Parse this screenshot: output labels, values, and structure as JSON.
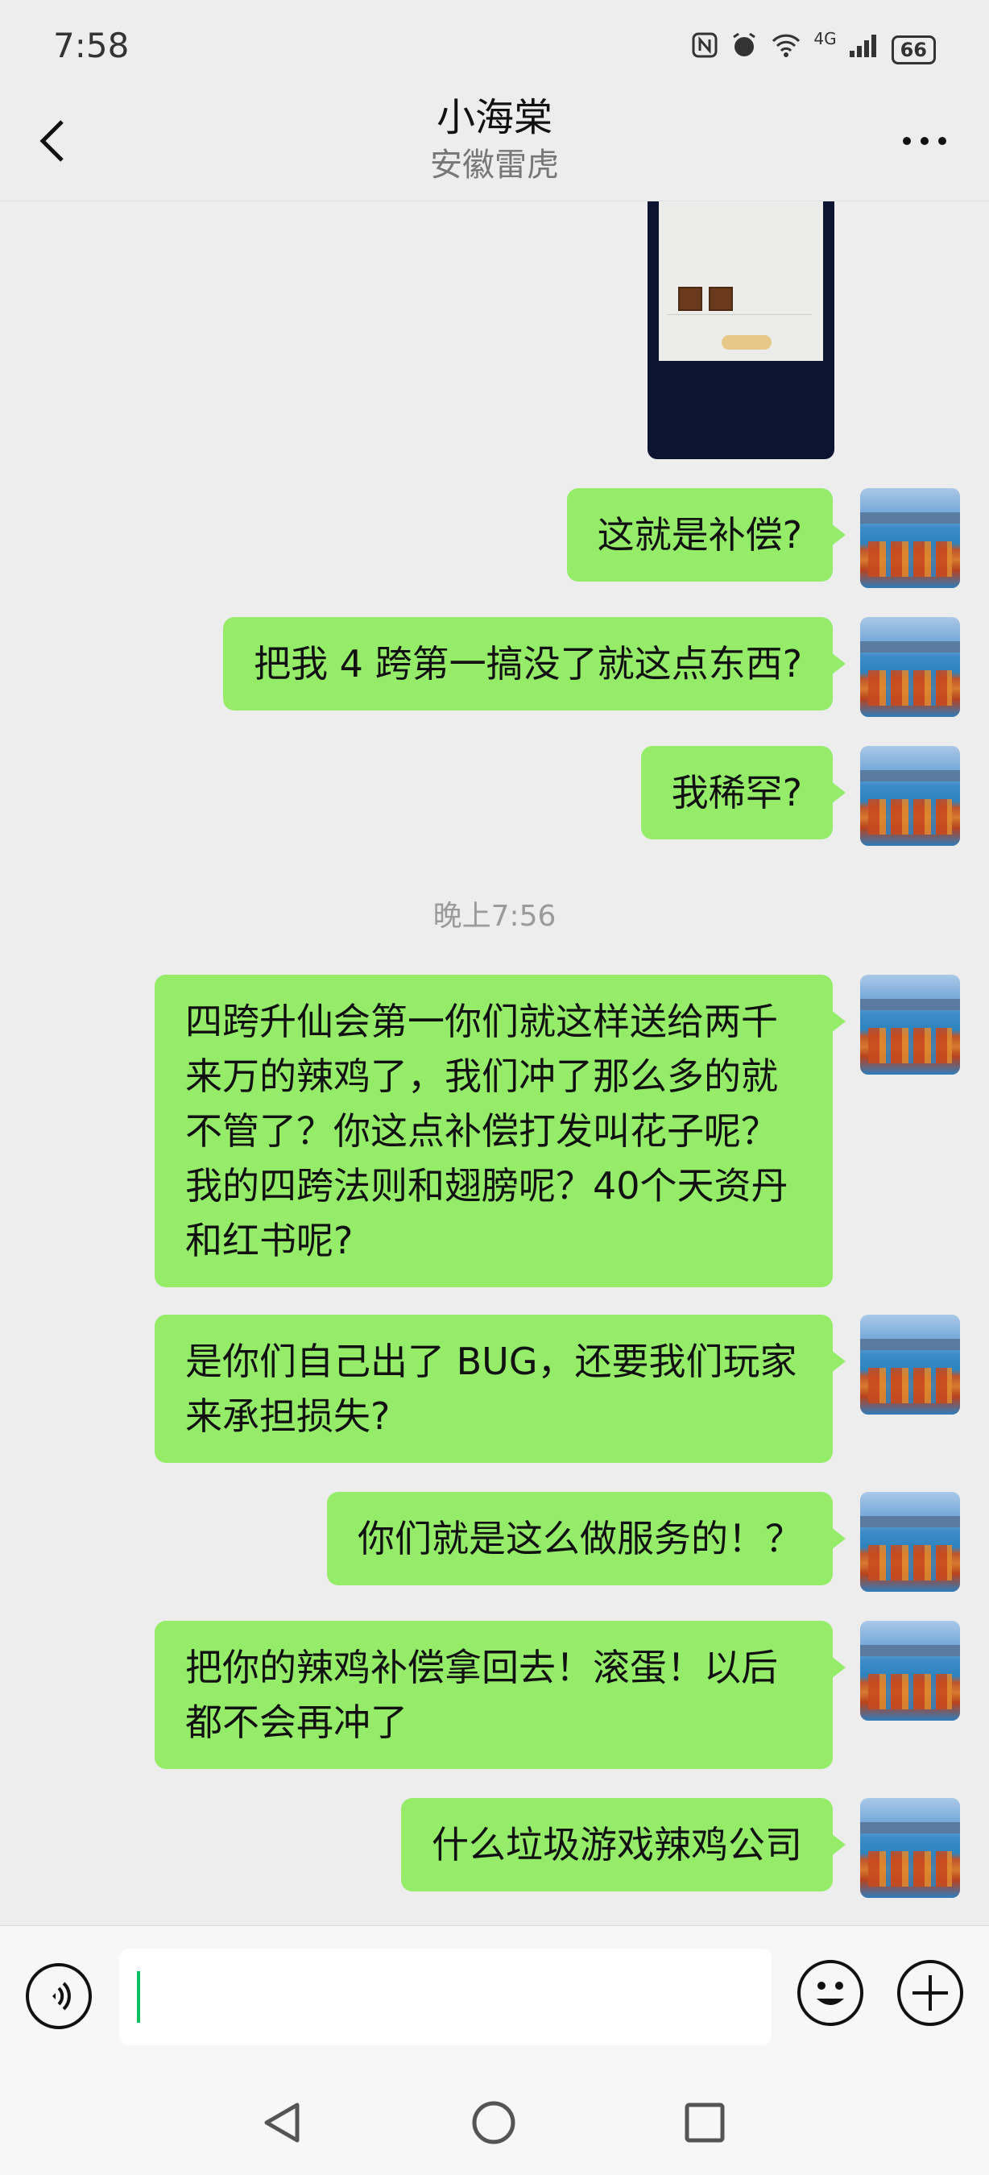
{
  "status_bar": {
    "time": "7:58",
    "icons": [
      "nfc-icon",
      "alarm-icon",
      "wifi-icon",
      "signal-icon"
    ],
    "network": "4G",
    "battery": "66"
  },
  "header": {
    "title": "小海棠",
    "subtitle": "安徽雷虎"
  },
  "messages": [
    {
      "type": "image",
      "sender": "self"
    },
    {
      "type": "text",
      "sender": "self",
      "text": "这就是补偿?"
    },
    {
      "type": "text",
      "sender": "self",
      "text": "把我 4 跨第一搞没了就这点东西?"
    },
    {
      "type": "text",
      "sender": "self",
      "text": "我稀罕?"
    },
    {
      "type": "time",
      "text": "晚上7:56"
    },
    {
      "type": "text",
      "sender": "self",
      "text": "四跨升仙会第一你们就这样送给两千来万的辣鸡了，我们冲了那么多的就不管了？你这点补偿打发叫花子呢？我的四跨法则和翅膀呢？40个天资丹和红书呢?"
    },
    {
      "type": "text",
      "sender": "self",
      "text": "是你们自己出了 BUG，还要我们玩家来承担损失?"
    },
    {
      "type": "text",
      "sender": "self",
      "text": "你们就是这么做服务的！？"
    },
    {
      "type": "text",
      "sender": "self",
      "text": "把你的辣鸡补偿拿回去！滚蛋！以后都不会再冲了"
    },
    {
      "type": "text",
      "sender": "self",
      "text": "什么垃圾游戏辣鸡公司"
    }
  ],
  "input": {
    "value": "",
    "placeholder": ""
  },
  "colors": {
    "bubble_self": "#95ec69",
    "background": "#ededed",
    "caret": "#07c160"
  }
}
